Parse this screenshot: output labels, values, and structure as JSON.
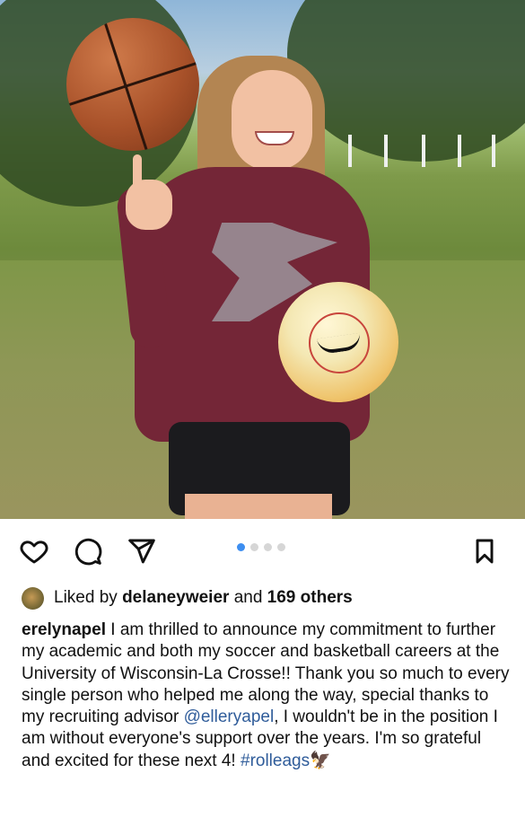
{
  "post": {
    "carousel": {
      "count": 4,
      "active_index": 0
    },
    "likes": {
      "prefix": "Liked by",
      "user": "delaneyweier",
      "joiner": "and",
      "others": "169 others"
    },
    "caption": {
      "username": "erelynapel",
      "text_part1": "I am thrilled to announce my commitment to further my academic and both my soccer and basketball careers at the University of Wisconsin-La Crosse!! Thank you so much to every single person who helped me along the way, special thanks to my recruiting advisor",
      "mention": "@elleryapel",
      "text_part2": ", I wouldn't be in the position I am without everyone's support over the years. I'm so grateful and excited for these next 4!",
      "hashtag": "#rolleags",
      "emoji": "🦅"
    }
  },
  "icons": {
    "like": "heart-icon",
    "comment": "comment-icon",
    "share": "send-icon",
    "save": "bookmark-icon"
  },
  "colors": {
    "link": "#2f5c9a",
    "dot_active": "#3d8ef0",
    "dot_inactive": "#d6d6d6"
  }
}
